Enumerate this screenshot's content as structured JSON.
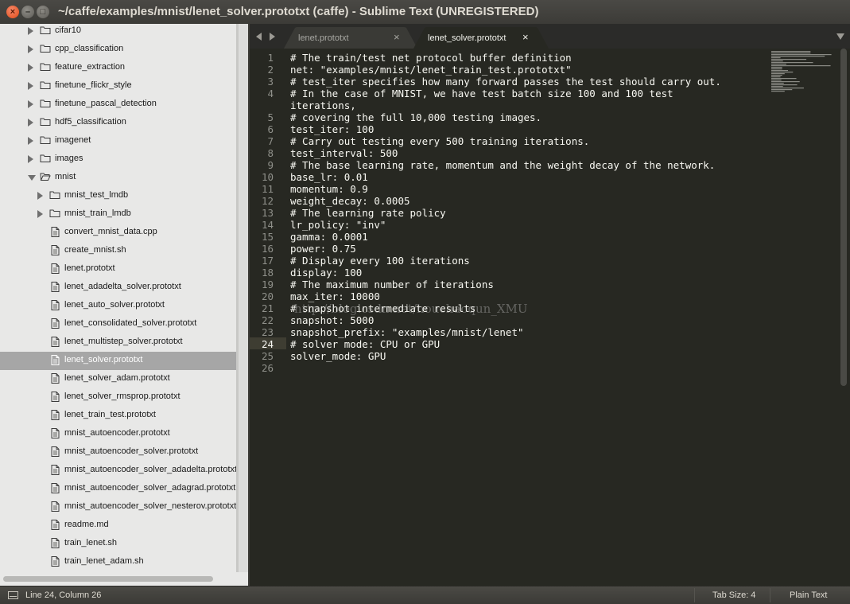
{
  "window": {
    "title": "~/caffe/examples/mnist/lenet_solver.prototxt (caffe) - Sublime Text (UNREGISTERED)",
    "close_glyph": "×",
    "minimize_glyph": "–",
    "maximize_glyph": "□"
  },
  "sidebar": {
    "items": [
      {
        "label": "cifar10",
        "type": "folder",
        "level": 0,
        "expanded": false
      },
      {
        "label": "cpp_classification",
        "type": "folder",
        "level": 0,
        "expanded": false
      },
      {
        "label": "feature_extraction",
        "type": "folder",
        "level": 0,
        "expanded": false
      },
      {
        "label": "finetune_flickr_style",
        "type": "folder",
        "level": 0,
        "expanded": false
      },
      {
        "label": "finetune_pascal_detection",
        "type": "folder",
        "level": 0,
        "expanded": false
      },
      {
        "label": "hdf5_classification",
        "type": "folder",
        "level": 0,
        "expanded": false
      },
      {
        "label": "imagenet",
        "type": "folder",
        "level": 0,
        "expanded": false
      },
      {
        "label": "images",
        "type": "folder",
        "level": 0,
        "expanded": false
      },
      {
        "label": "mnist",
        "type": "folder",
        "level": 0,
        "expanded": true
      },
      {
        "label": "mnist_test_lmdb",
        "type": "folder",
        "level": 1,
        "expanded": false
      },
      {
        "label": "mnist_train_lmdb",
        "type": "folder",
        "level": 1,
        "expanded": false
      },
      {
        "label": "convert_mnist_data.cpp",
        "type": "file",
        "level": 1
      },
      {
        "label": "create_mnist.sh",
        "type": "file",
        "level": 1
      },
      {
        "label": "lenet.prototxt",
        "type": "file",
        "level": 1
      },
      {
        "label": "lenet_adadelta_solver.prototxt",
        "type": "file",
        "level": 1
      },
      {
        "label": "lenet_auto_solver.prototxt",
        "type": "file",
        "level": 1
      },
      {
        "label": "lenet_consolidated_solver.prototxt",
        "type": "file",
        "level": 1
      },
      {
        "label": "lenet_multistep_solver.prototxt",
        "type": "file",
        "level": 1
      },
      {
        "label": "lenet_solver.prototxt",
        "type": "file",
        "level": 1,
        "selected": true
      },
      {
        "label": "lenet_solver_adam.prototxt",
        "type": "file",
        "level": 1
      },
      {
        "label": "lenet_solver_rmsprop.prototxt",
        "type": "file",
        "level": 1
      },
      {
        "label": "lenet_train_test.prototxt",
        "type": "file",
        "level": 1
      },
      {
        "label": "mnist_autoencoder.prototxt",
        "type": "file",
        "level": 1
      },
      {
        "label": "mnist_autoencoder_solver.prototxt",
        "type": "file",
        "level": 1
      },
      {
        "label": "mnist_autoencoder_solver_adadelta.prototxt",
        "type": "file",
        "level": 1
      },
      {
        "label": "mnist_autoencoder_solver_adagrad.prototxt",
        "type": "file",
        "level": 1
      },
      {
        "label": "mnist_autoencoder_solver_nesterov.prototxt",
        "type": "file",
        "level": 1
      },
      {
        "label": "readme.md",
        "type": "file",
        "level": 1
      },
      {
        "label": "train_lenet.sh",
        "type": "file",
        "level": 1
      },
      {
        "label": "train_lenet_adam.sh",
        "type": "file",
        "level": 1
      }
    ]
  },
  "tabs": [
    {
      "label": "lenet.prototxt",
      "active": false,
      "close": "×"
    },
    {
      "label": "lenet_solver.prototxt",
      "active": true,
      "close": "×"
    }
  ],
  "editor": {
    "current_line": 24,
    "watermark": "http://blog.csdn.net/houchaoqun_XMU",
    "lines": [
      {
        "n": "1",
        "text": "# The train/test net protocol buffer definition"
      },
      {
        "n": "2",
        "text": "net: \"examples/mnist/lenet_train_test.prototxt\""
      },
      {
        "n": "3",
        "text": "# test_iter specifies how many forward passes the test should carry out."
      },
      {
        "n": "4",
        "text": "# In the case of MNIST, we have test batch size 100 and 100 test"
      },
      {
        "n": "",
        "text": "iterations,"
      },
      {
        "n": "5",
        "text": "# covering the full 10,000 testing images."
      },
      {
        "n": "6",
        "text": "test_iter: 100"
      },
      {
        "n": "7",
        "text": "# Carry out testing every 500 training iterations."
      },
      {
        "n": "8",
        "text": "test_interval: 500"
      },
      {
        "n": "9",
        "text": "# The base learning rate, momentum and the weight decay of the network."
      },
      {
        "n": "10",
        "text": "base_lr: 0.01"
      },
      {
        "n": "11",
        "text": "momentum: 0.9"
      },
      {
        "n": "12",
        "text": "weight_decay: 0.0005"
      },
      {
        "n": "13",
        "text": "# The learning rate policy"
      },
      {
        "n": "14",
        "text": "lr_policy: \"inv\""
      },
      {
        "n": "15",
        "text": "gamma: 0.0001"
      },
      {
        "n": "16",
        "text": "power: 0.75"
      },
      {
        "n": "17",
        "text": "# Display every 100 iterations"
      },
      {
        "n": "18",
        "text": "display: 100"
      },
      {
        "n": "19",
        "text": "# The maximum number of iterations"
      },
      {
        "n": "20",
        "text": "max_iter: 10000"
      },
      {
        "n": "21",
        "text": "# snapshot intermediate results"
      },
      {
        "n": "22",
        "text": "snapshot: 5000"
      },
      {
        "n": "23",
        "text": "snapshot_prefix: \"examples/mnist/lenet\""
      },
      {
        "n": "24",
        "text": "# solver mode: CPU or GPU"
      },
      {
        "n": "25",
        "text": "solver_mode: GPU"
      },
      {
        "n": "26",
        "text": ""
      }
    ]
  },
  "status": {
    "position": "Line 24, Column 26",
    "tab_size": "Tab Size: 4",
    "syntax": "Plain Text"
  },
  "colors": {
    "editor_bg": "#272822",
    "sidebar_bg": "#e8e8e7",
    "selection": "#a6a6a6",
    "text": "#f8f8f2"
  }
}
